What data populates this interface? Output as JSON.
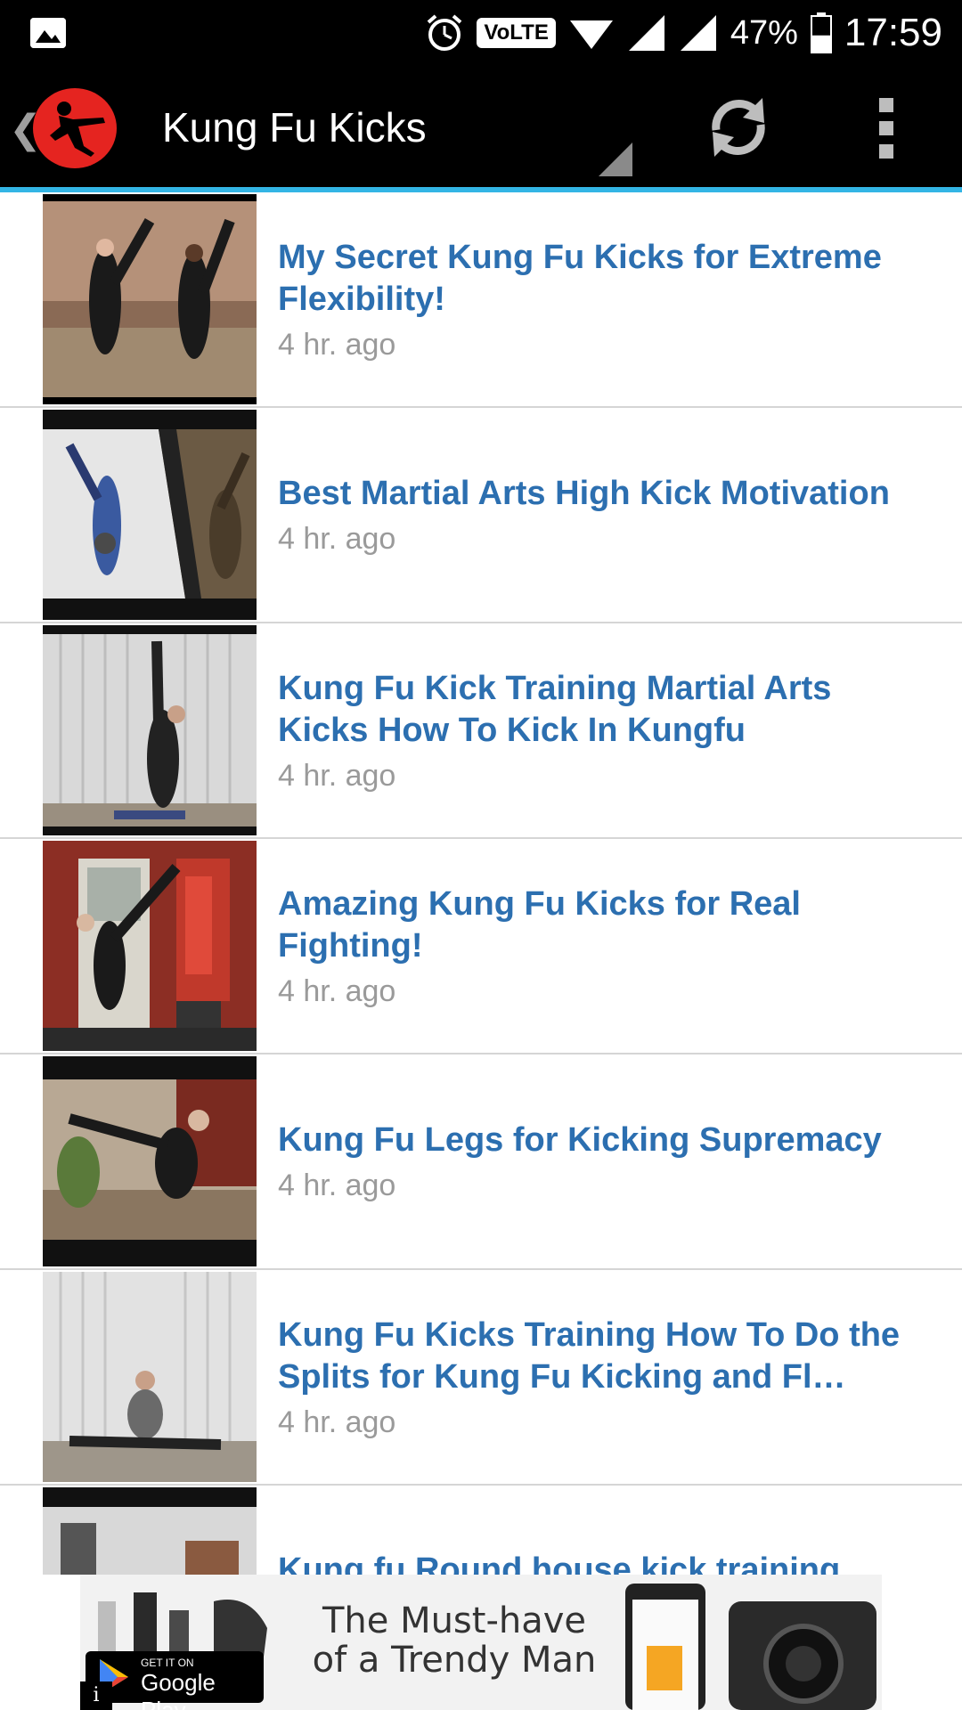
{
  "status_bar": {
    "volte": "VoLTE",
    "battery_percent": "47%",
    "battery_level": 0.47,
    "time": "17:59"
  },
  "action_bar": {
    "title": "Kung Fu Kicks",
    "icons": [
      "back-chevron-icon",
      "app-logo-icon",
      "spinner-triangle-icon",
      "refresh-icon",
      "overflow-menu-icon"
    ]
  },
  "videos": [
    {
      "title": "My Secret Kung Fu Kicks for Extreme Flexibility!",
      "time": "4 hr. ago"
    },
    {
      "title": "Best Martial Arts High Kick Motivation",
      "time": "4 hr. ago"
    },
    {
      "title": "Kung Fu Kick Training Martial Arts Kicks How To Kick In Kungfu",
      "time": "4 hr. ago"
    },
    {
      "title": "Amazing Kung Fu Kicks for Real Fighting!",
      "time": "4 hr. ago"
    },
    {
      "title": "Kung Fu Legs for Kicking Supremacy",
      "time": "4 hr. ago"
    },
    {
      "title": "Kung Fu Kicks Training How To Do the Splits for Kung Fu Kicking and Fl…",
      "time": "4 hr. ago"
    },
    {
      "title": "Kung fu Round house kick training",
      "time": ""
    }
  ],
  "ad": {
    "headline": "The Must-have of a Trendy Man",
    "badge_small": "GET IT ON",
    "badge_big": "Google Play",
    "info": "i"
  },
  "colors": {
    "title_blue": "#2c6fb0",
    "accent_line": "#33b5e5",
    "time_gray": "#9a9a9a"
  }
}
